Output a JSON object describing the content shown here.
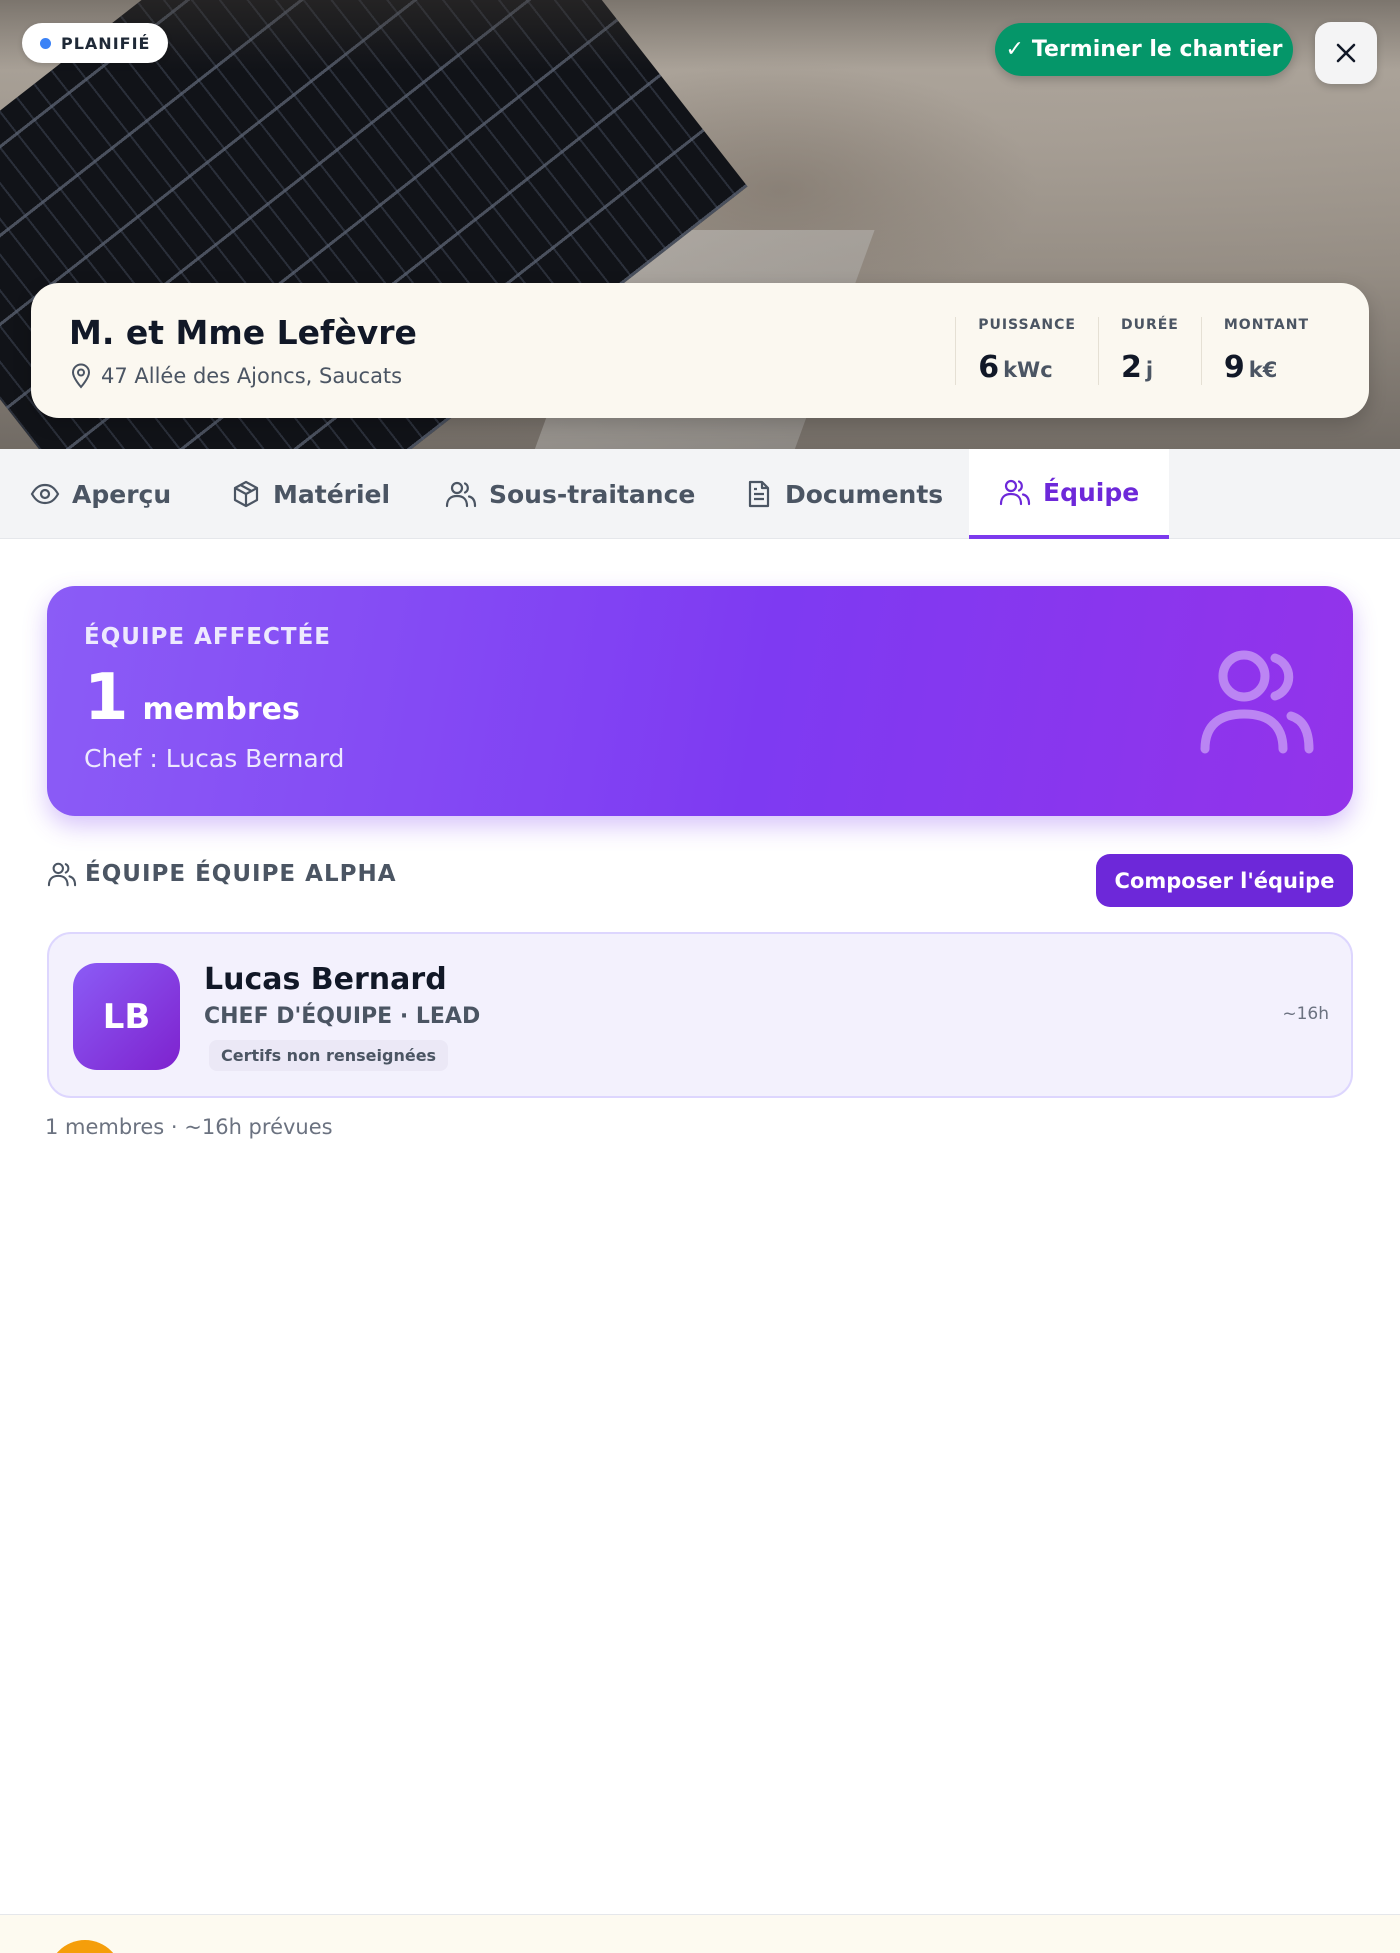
{
  "hero": {
    "status": "PLANIFIÉ",
    "status_color": "#3b82f6",
    "finish_button": "Terminer le chantier",
    "finish_check": "✓",
    "finish_color": "#059669",
    "close_icon": "close-icon"
  },
  "project": {
    "client": "M. et Mme Lefèvre",
    "address": "47 Allée des Ajoncs, Saucats",
    "stats": [
      {
        "label": "PUISSANCE",
        "value": "6",
        "unit": "kWc"
      },
      {
        "label": "DURÉE",
        "value": "2",
        "unit": "j"
      },
      {
        "label": "MONTANT",
        "value": "9",
        "unit": "k€"
      }
    ]
  },
  "tabs": [
    {
      "label": "Aperçu",
      "icon": "eye-icon"
    },
    {
      "label": "Matériel",
      "icon": "box-icon"
    },
    {
      "label": "Sous-traitance",
      "icon": "users-icon"
    },
    {
      "label": "Documents",
      "icon": "document-icon"
    },
    {
      "label": "Équipe",
      "icon": "users-icon",
      "active": true
    }
  ],
  "team": {
    "label": "ÉQUIPE AFFECTÉE",
    "count": "1",
    "count_unit": "membres",
    "chef": "Chef : Lucas Bernard",
    "section_title": "ÉQUIPE ÉQUIPE ALPHA",
    "compose_button": "Composer l'équipe",
    "accent": "#7c3aed"
  },
  "members": [
    {
      "initials": "LB",
      "name": "Lucas Bernard",
      "role": "CHEF D'ÉQUIPE · LEAD",
      "badge": "Certifs non renseignées",
      "hours": "~16h"
    }
  ],
  "summary": "1 membres · ~16h prévues"
}
